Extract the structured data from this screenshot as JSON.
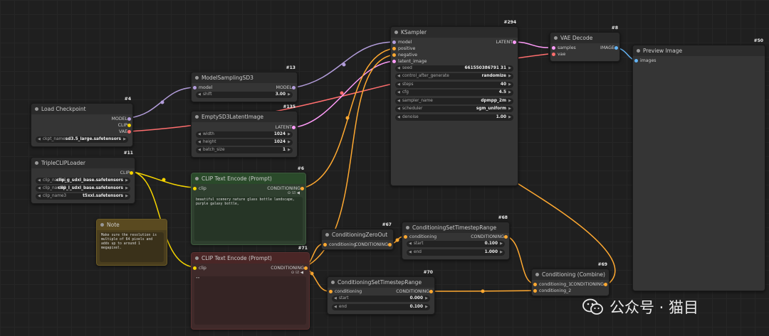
{
  "colors": {
    "clip": "#f5d400",
    "model": "#b39ddb",
    "vae": "#ff6e6e",
    "latent": "#ff9cf9",
    "conditioning": "#ffa931",
    "image": "#64b5f6"
  },
  "load_checkpoint": {
    "id": "#4",
    "title": "Load Checkpoint",
    "out_model": "MODEL",
    "out_clip": "CLIP",
    "out_vae": "VAE",
    "ckpt_label": "ckpt_name",
    "ckpt_value": "sd3.5_large.safetensors"
  },
  "triple_clip": {
    "id": "#11",
    "title": "TripleCLIPLoader",
    "out_clip": "CLIP",
    "rows": [
      {
        "label": "clip_name1",
        "value": "clip_g_sdxl_base.safetensors"
      },
      {
        "label": "clip_name2",
        "value": "clip_l_sdxl_base.safetensors"
      },
      {
        "label": "clip_name3",
        "value": "t5xxl.safetensors"
      }
    ]
  },
  "model_sampling": {
    "id": "#13",
    "title": "ModelSamplingSD3",
    "in_model": "model",
    "out_model": "MODEL",
    "shift_label": "shift",
    "shift_value": "3.00"
  },
  "empty_latent": {
    "id": "#135",
    "title": "EmptySD3LatentImage",
    "out_latent": "LATENT",
    "rows": [
      {
        "label": "width",
        "value": "1024"
      },
      {
        "label": "height",
        "value": "1024"
      },
      {
        "label": "batch_size",
        "value": "1"
      }
    ]
  },
  "clip_text_pos": {
    "id": "#6",
    "title": "CLIP Text Encode (Prompt)",
    "in_clip": "clip",
    "out": "CONDITIONING",
    "text": "beautiful scenery nature glass bottle landscape, purple galaxy bottle,"
  },
  "clip_text_neg": {
    "id": "#71",
    "title": "CLIP Text Encode (Prompt)",
    "in_clip": "clip",
    "out": "CONDITIONING",
    "text": "\"\""
  },
  "note": {
    "title": "Note",
    "text": "Make sure the resolution is multiple of 64 pixels and adds up to around 1 megapixel."
  },
  "ksampler": {
    "id": "#294",
    "title": "KSampler",
    "inputs": [
      "model",
      "positive",
      "negative",
      "latent_image"
    ],
    "out_latent": "LATENT",
    "rows": [
      {
        "label": "seed",
        "value": "661550386791 31"
      },
      {
        "label": "control_after_generate",
        "value": "randomize"
      },
      {
        "label": "steps",
        "value": "40"
      },
      {
        "label": "cfg",
        "value": "4.5"
      },
      {
        "label": "sampler_name",
        "value": "dpmpp_2m"
      },
      {
        "label": "scheduler",
        "value": "sgm_uniform"
      },
      {
        "label": "denoise",
        "value": "1.00"
      }
    ]
  },
  "vae_decode": {
    "id": "#8",
    "title": "VAE Decode",
    "in_samples": "samples",
    "in_vae": "vae",
    "out_image": "IMAGE"
  },
  "preview": {
    "id": "#50",
    "title": "Preview Image",
    "in_images": "images"
  },
  "cond_zero": {
    "id": "#67",
    "title": "ConditioningZeroOut",
    "in": "conditioning",
    "out": "CONDITIONING"
  },
  "cond_range_68": {
    "id": "#68",
    "title": "ConditioningSetTimestepRange",
    "in": "conditioning",
    "out": "CONDITIONING",
    "rows": [
      {
        "label": "start",
        "value": "0.100"
      },
      {
        "label": "end",
        "value": "1.000"
      }
    ]
  },
  "cond_range_70": {
    "id": "#70",
    "title": "ConditioningSetTimestepRange",
    "in": "conditioning",
    "out": "CONDITIONING",
    "rows": [
      {
        "label": "start",
        "value": "0.000"
      },
      {
        "label": "end",
        "value": "0.100"
      }
    ]
  },
  "cond_combine": {
    "id": "#69",
    "title": "Conditioning (Combine)",
    "in1": "conditioning_1",
    "in2": "conditioning_2",
    "out": "CONDITIONING"
  },
  "watermark": {
    "text": "公众号 · 猫目"
  }
}
